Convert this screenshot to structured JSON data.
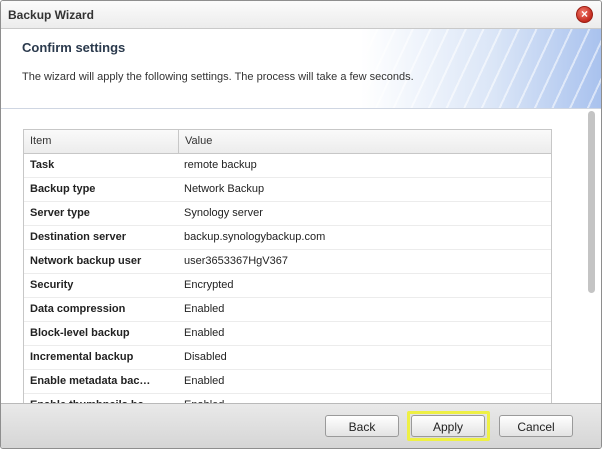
{
  "window": {
    "title": "Backup Wizard",
    "close_icon": "close-icon"
  },
  "header": {
    "heading": "Confirm settings",
    "description": "The wizard will apply the following settings. The process will take a few seconds."
  },
  "grid": {
    "columns": [
      "Item",
      "Value"
    ],
    "rows": [
      {
        "item": "Task",
        "value": "remote backup"
      },
      {
        "item": "Backup type",
        "value": "Network Backup"
      },
      {
        "item": "Server type",
        "value": "Synology server"
      },
      {
        "item": "Destination server",
        "value": "backup.synologybackup.com"
      },
      {
        "item": "Network backup user",
        "value": "user3653367HgV367"
      },
      {
        "item": "Security",
        "value": "Encrypted"
      },
      {
        "item": "Data compression",
        "value": "Enabled"
      },
      {
        "item": "Block-level backup",
        "value": "Enabled"
      },
      {
        "item": "Incremental backup",
        "value": "Disabled"
      },
      {
        "item": "Enable metadata bac…",
        "value": "Enabled"
      },
      {
        "item": "Enable thumbnails ba…",
        "value": "Enabled"
      }
    ]
  },
  "footer": {
    "back_label": "Back",
    "apply_label": "Apply",
    "cancel_label": "Cancel"
  },
  "colors": {
    "highlight": "#eef045",
    "close_button": "#c32a1e"
  }
}
